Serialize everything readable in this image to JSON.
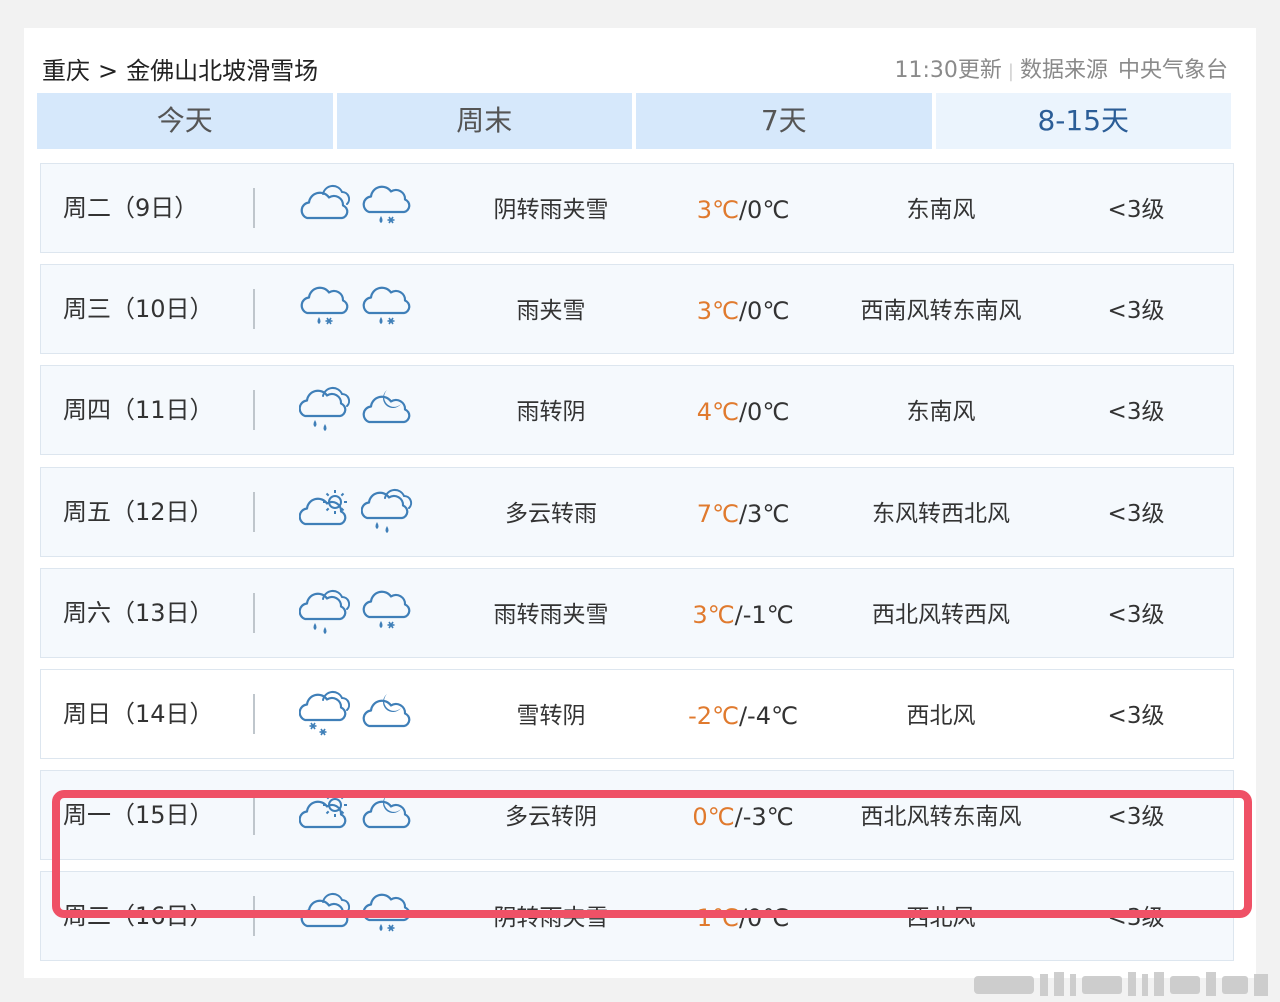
{
  "location": {
    "city": "重庆",
    "separator": ">",
    "place": "金佛山北坡滑雪场"
  },
  "meta": {
    "update": "11:30更新",
    "source_label": "数据来源",
    "source": "中央气象台"
  },
  "tabs": [
    {
      "label": "今天",
      "active": false
    },
    {
      "label": "周末",
      "active": false
    },
    {
      "label": "7天",
      "active": false
    },
    {
      "label": "8-15天",
      "active": true
    }
  ],
  "rows": [
    {
      "day": "周二（9日）",
      "icon_day": "cloudy-icon",
      "icon_night": "sleet-icon",
      "desc": "阴转雨夹雪",
      "hi": "3℃",
      "lo": "0℃",
      "wind": "东南风",
      "level": "<3级"
    },
    {
      "day": "周三（10日）",
      "icon_day": "sleet-icon",
      "icon_night": "sleet-icon",
      "desc": "雨夹雪",
      "hi": "3℃",
      "lo": "0℃",
      "wind": "西南风转东南风",
      "level": "<3级"
    },
    {
      "day": "周四（11日）",
      "icon_day": "rain-icon",
      "icon_night": "cloudy-night-icon",
      "desc": "雨转阴",
      "hi": "4℃",
      "lo": "0℃",
      "wind": "东南风",
      "level": "<3级"
    },
    {
      "day": "周五（12日）",
      "icon_day": "partly-cloudy-icon",
      "icon_night": "rain-icon",
      "desc": "多云转雨",
      "hi": "7℃",
      "lo": "3℃",
      "wind": "东风转西北风",
      "level": "<3级"
    },
    {
      "day": "周六（13日）",
      "icon_day": "rain-icon",
      "icon_night": "sleet-icon",
      "desc": "雨转雨夹雪",
      "hi": "3℃",
      "lo": "-1℃",
      "wind": "西北风转西风",
      "level": "<3级"
    },
    {
      "day": "周日（14日）",
      "icon_day": "snow-icon",
      "icon_night": "cloudy-night-icon",
      "desc": "雪转阴",
      "hi": "-2℃",
      "lo": "-4℃",
      "wind": "西北风",
      "level": "<3级",
      "highlighted": true
    },
    {
      "day": "周一（15日）",
      "icon_day": "partly-cloudy-icon",
      "icon_night": "cloudy-night-icon",
      "desc": "多云转阴",
      "hi": "0℃",
      "lo": "-3℃",
      "wind": "西北风转东南风",
      "level": "<3级"
    },
    {
      "day": "周二（16日）",
      "icon_day": "cloudy-icon",
      "icon_night": "sleet-icon",
      "desc": "阴转雨夹雪",
      "hi": "1℃",
      "lo": "0℃",
      "wind": "西北风",
      "level": "<3级"
    }
  ],
  "colors": {
    "high_temp": "#e07a2e",
    "tab_active_text": "#2b5d97",
    "highlight_border": "#ef5166",
    "icon_stroke": "#3f7fb8"
  }
}
